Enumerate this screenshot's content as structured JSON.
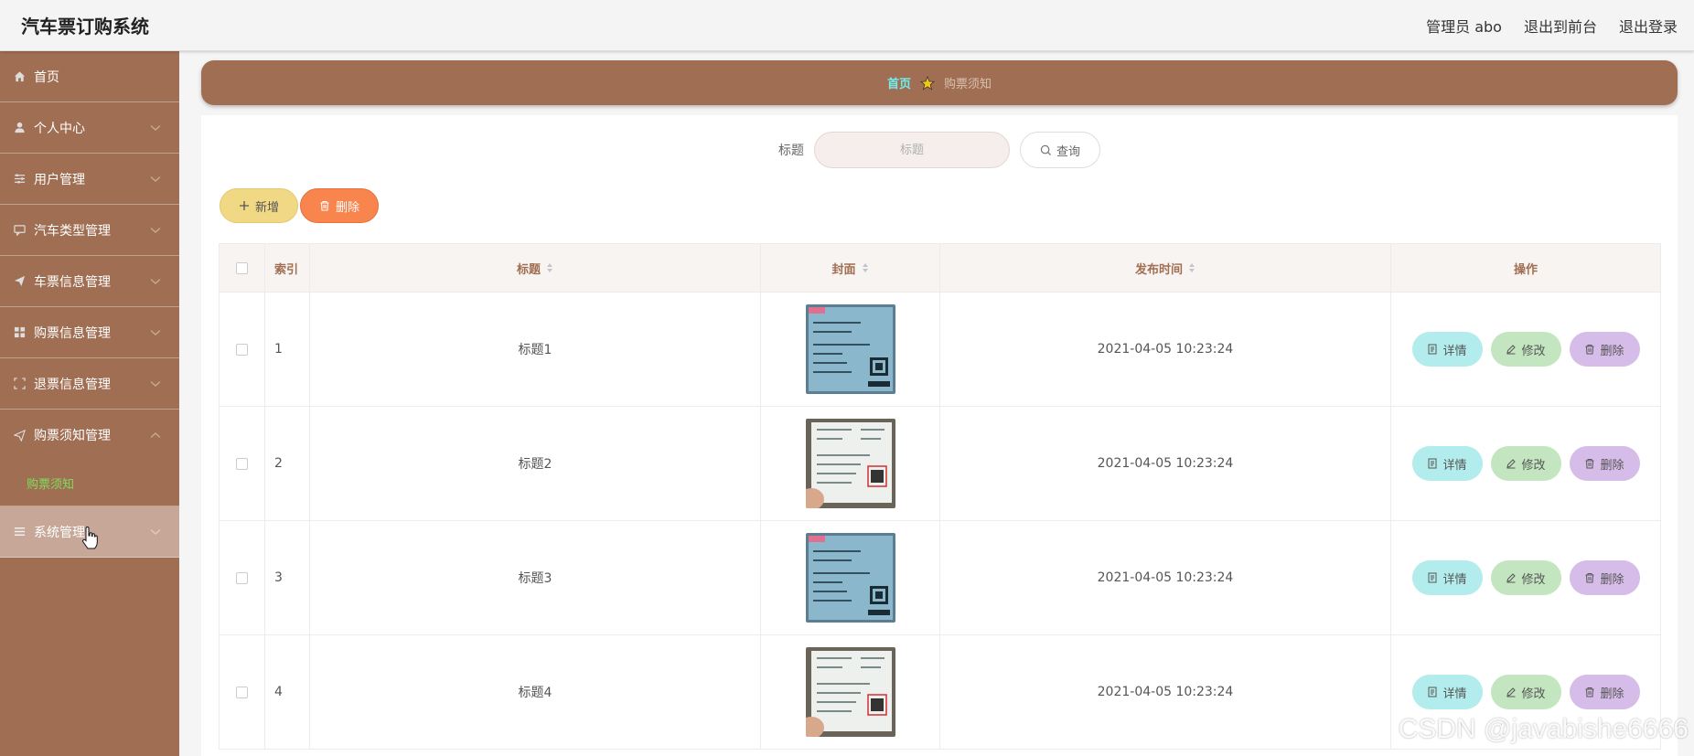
{
  "app": {
    "title": "汽车票订购系统"
  },
  "header": {
    "user_label": "管理员 abo",
    "to_front_label": "退出到前台",
    "logout_label": "退出登录"
  },
  "sidebar": {
    "items": [
      {
        "label": "首页",
        "icon": "home-icon"
      },
      {
        "label": "个人中心",
        "icon": "user-icon"
      },
      {
        "label": "用户管理",
        "icon": "sliders-icon"
      },
      {
        "label": "汽车类型管理",
        "icon": "chat-icon"
      },
      {
        "label": "车票信息管理",
        "icon": "send-icon"
      },
      {
        "label": "购票信息管理",
        "icon": "grid-icon"
      },
      {
        "label": "退票信息管理",
        "icon": "frame-icon"
      },
      {
        "label": "购票须知管理",
        "icon": "send-icon"
      },
      {
        "label": "系统管理",
        "icon": "list-icon"
      }
    ],
    "submenu": {
      "label": "购票须知"
    }
  },
  "breadcrumb": {
    "home": "首页",
    "current": "购票须知"
  },
  "search": {
    "label": "标题",
    "placeholder": "标题",
    "button_label": "查询"
  },
  "actions": {
    "add_label": "新增",
    "delete_label": "删除"
  },
  "table": {
    "headers": {
      "index": "索引",
      "title": "标题",
      "cover": "封面",
      "time": "发布时间",
      "ops": "操作"
    },
    "ops": {
      "detail": "详情",
      "edit": "修改",
      "delete": "删除"
    },
    "rows": [
      {
        "index": "1",
        "title": "标题1",
        "time": "2021-04-05 10:23:24",
        "cover": "blue-ticket"
      },
      {
        "index": "2",
        "title": "标题2",
        "time": "2021-04-05 10:23:24",
        "cover": "white-ticket"
      },
      {
        "index": "3",
        "title": "标题3",
        "time": "2021-04-05 10:23:24",
        "cover": "blue-ticket"
      },
      {
        "index": "4",
        "title": "标题4",
        "time": "2021-04-05 10:23:24",
        "cover": "white-ticket"
      }
    ]
  },
  "watermark": "CSDN @javabishe6666",
  "colors": {
    "sidebar": "#a06e52",
    "breadcrumb_home": "#6ff0ee",
    "submenu_active": "#7dde5e",
    "add_button": "#f0d885",
    "delete_button": "#f8844e",
    "detail_button": "#b3ecec",
    "edit_button": "#c3e6c0",
    "row_delete_button": "#d6bce8"
  }
}
